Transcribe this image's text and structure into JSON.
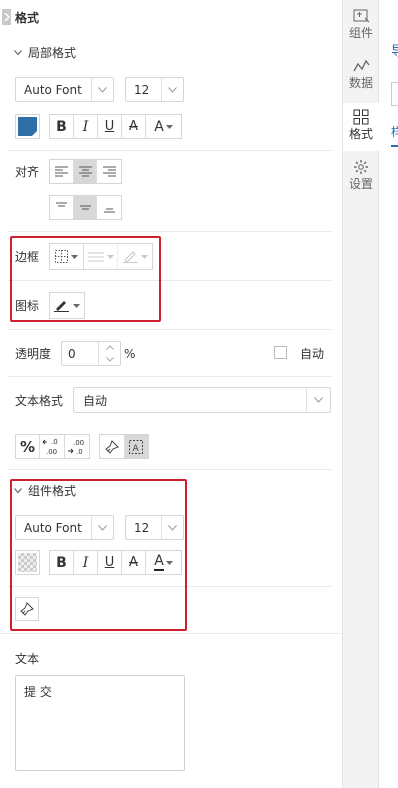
{
  "header": {
    "title": "格式"
  },
  "local": {
    "section_title": "局部格式",
    "font_family": "Auto Font",
    "font_size": "12",
    "align_label": "对齐",
    "border_label": "边框",
    "icon_label": "图标",
    "opacity_label": "透明度",
    "opacity_value": "0",
    "opacity_unit": "%",
    "auto_label": "自动",
    "text_format_label": "文本格式",
    "text_format_value": "自动",
    "format_buttons": [
      "%",
      ".0 .00",
      ".00 .0"
    ]
  },
  "widget": {
    "section_title": "组件格式",
    "font_family": "Auto Font",
    "font_size": "12"
  },
  "text_section": {
    "label": "文本",
    "value": "提 交"
  },
  "rail": {
    "items": [
      {
        "label": "组件"
      },
      {
        "label": "数据"
      },
      {
        "label": "格式"
      },
      {
        "label": "设置"
      }
    ]
  },
  "edge": {
    "text1": "导",
    "text2": "样"
  },
  "colors": {
    "fill_color": "#2f6fa8",
    "accent": "#2a6fb5",
    "highlight_box": "#d0202e"
  }
}
